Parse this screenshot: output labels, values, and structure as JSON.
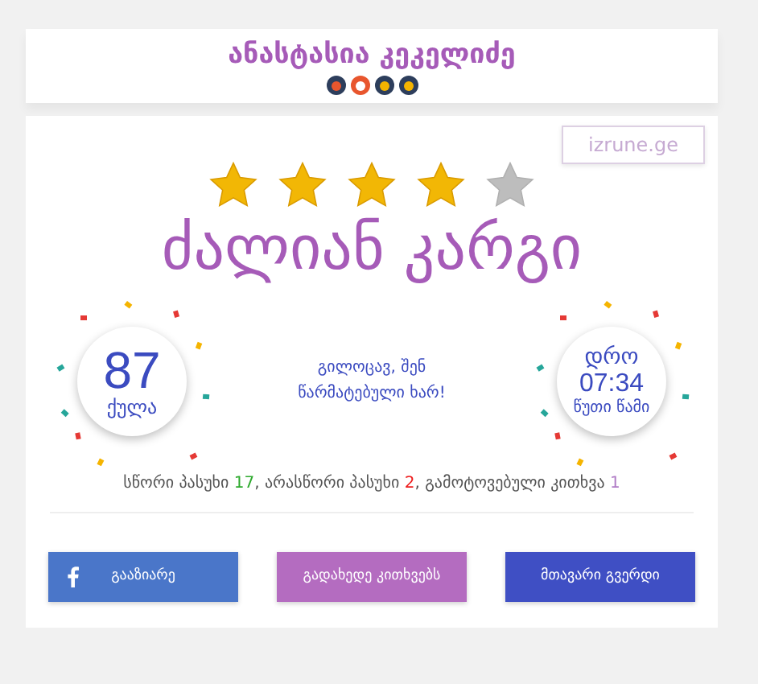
{
  "header": {
    "name": "ანასტასია კეკელიძე"
  },
  "logo": "izrune.ge",
  "stars": 4,
  "rating": "ძალიან კარგი",
  "score": {
    "value": "87",
    "label": "ქულა"
  },
  "message": "გილოცავ, შენ წარმატებული ხარ!",
  "time": {
    "label": "დრო",
    "value": "07:34",
    "units": "წუთი წამი"
  },
  "summary": [
    {
      "text": "სწორი პასუხი ",
      "count": "17",
      "color": "#2eaa2e"
    },
    {
      "text": ", არასწორი პასუხი ",
      "count": "2",
      "color": "#ee1c1c"
    },
    {
      "text": ", გამოტოვებული კითხვა ",
      "count": "1",
      "color": "#b07cc6"
    }
  ],
  "buttons": [
    {
      "kind": "facebook",
      "label": "გააზიარე"
    },
    {
      "kind": "review",
      "label": "გადახედე კითხვებს"
    },
    {
      "kind": "home",
      "label": "მთავარი გვერდი"
    }
  ]
}
